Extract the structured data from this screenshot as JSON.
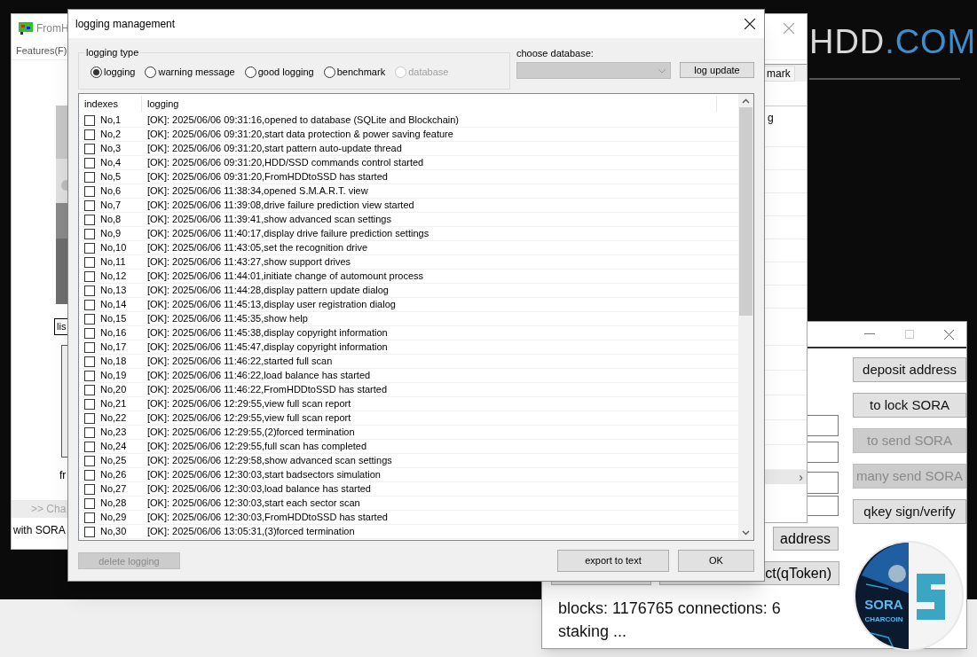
{
  "desktop": {
    "brand": "HDD",
    "brand_suffix": ".COM"
  },
  "background_window": {
    "title": "FromH",
    "menu": [
      "Features(F)"
    ],
    "tab": "mark",
    "list_text": "g",
    "field_text": "lis",
    "label": "fr",
    "bar_text": ">> Cha",
    "status_text": "with SORA"
  },
  "dropdown_list": {
    "arrow": "›"
  },
  "wallet_window": {
    "buttons": [
      {
        "label": "deposit address",
        "disabled": false
      },
      {
        "label": "to lock SORA",
        "disabled": false
      },
      {
        "label": "to send SORA",
        "disabled": true
      },
      {
        "label": "many send SORA",
        "disabled": true
      },
      {
        "label": "qkey sign/verify",
        "disabled": false
      }
    ],
    "address_button": "address",
    "token_button": "ct(qToken)",
    "status_lines": [
      "blocks: 1176765 connections: 6",
      "staking ..."
    ],
    "logo": {
      "title": "SORA",
      "subtitle": "CHARCOIN"
    }
  },
  "dialog": {
    "title": "logging management",
    "group_label": "logging type",
    "radios": [
      {
        "label": "logging",
        "selected": true,
        "disabled": false
      },
      {
        "label": "warning message",
        "selected": false,
        "disabled": false
      },
      {
        "label": "good logging",
        "selected": false,
        "disabled": false
      },
      {
        "label": "benchmark",
        "selected": false,
        "disabled": false
      },
      {
        "label": "database",
        "selected": false,
        "disabled": true
      }
    ],
    "database_label": "choose database:",
    "update_button": "log update",
    "columns": [
      "indexes",
      "logging"
    ],
    "rows": [
      {
        "index": "No,1",
        "text": "[OK]: 2025/06/06 09:31:16,opened to database (SQLite and Blockchain)",
        "checked": false
      },
      {
        "index": "No,2",
        "text": "[OK]: 2025/06/06 09:31:20,start data protection & power saving feature",
        "checked": false
      },
      {
        "index": "No,3",
        "text": "[OK]: 2025/06/06 09:31:20,start pattern auto-update thread",
        "checked": false
      },
      {
        "index": "No,4",
        "text": "[OK]: 2025/06/06 09:31:20,HDD/SSD commands control started",
        "checked": false
      },
      {
        "index": "No,5",
        "text": "[OK]: 2025/06/06 09:31:20,FromHDDtoSSD has started",
        "checked": false
      },
      {
        "index": "No,6",
        "text": "[OK]: 2025/06/06 11:38:34,opened S.M.A.R.T. view",
        "checked": false
      },
      {
        "index": "No,7",
        "text": "[OK]: 2025/06/06 11:39:08,drive failure prediction view started",
        "checked": false
      },
      {
        "index": "No,8",
        "text": "[OK]: 2025/06/06 11:39:41,show advanced scan settings",
        "checked": false
      },
      {
        "index": "No,9",
        "text": "[OK]: 2025/06/06 11:40:17,display drive failure prediction settings",
        "checked": false
      },
      {
        "index": "No,10",
        "text": "[OK]: 2025/06/06 11:43:05,set the recognition drive",
        "checked": false
      },
      {
        "index": "No,11",
        "text": "[OK]: 2025/06/06 11:43:27,show support drives",
        "checked": false
      },
      {
        "index": "No,12",
        "text": "[OK]: 2025/06/06 11:44:01,initiate change of automount process",
        "checked": false
      },
      {
        "index": "No,13",
        "text": "[OK]: 2025/06/06 11:44:28,display pattern update dialog",
        "checked": false
      },
      {
        "index": "No,14",
        "text": "[OK]: 2025/06/06 11:45:13,display user registration dialog",
        "checked": false
      },
      {
        "index": "No,15",
        "text": "[OK]: 2025/06/06 11:45:35,show help",
        "checked": false
      },
      {
        "index": "No,16",
        "text": "[OK]: 2025/06/06 11:45:38,display copyright information",
        "checked": false
      },
      {
        "index": "No,17",
        "text": "[OK]: 2025/06/06 11:45:47,display copyright information",
        "checked": false
      },
      {
        "index": "No,18",
        "text": "[OK]: 2025/06/06 11:46:22,started full scan",
        "checked": false
      },
      {
        "index": "No,19",
        "text": "[OK]: 2025/06/06 11:46:22,load balance has started",
        "checked": false
      },
      {
        "index": "No,20",
        "text": "[OK]: 2025/06/06 11:46:22,FromHDDtoSSD has started",
        "checked": false
      },
      {
        "index": "No,21",
        "text": "[OK]: 2025/06/06 12:29:55,view full scan report",
        "checked": false
      },
      {
        "index": "No,22",
        "text": "[OK]: 2025/06/06 12:29:55,view full scan report",
        "checked": false
      },
      {
        "index": "No,23",
        "text": "[OK]: 2025/06/06 12:29:55,(2)forced termination",
        "checked": false
      },
      {
        "index": "No,24",
        "text": "[OK]: 2025/06/06 12:29:55,full scan has completed",
        "checked": false
      },
      {
        "index": "No,25",
        "text": "[OK]: 2025/06/06 12:29:58,show advanced scan settings",
        "checked": false
      },
      {
        "index": "No,26",
        "text": "[OK]: 2025/06/06 12:30:03,start badsectors simulation",
        "checked": false
      },
      {
        "index": "No,27",
        "text": "[OK]: 2025/06/06 12:30:03,load balance has started",
        "checked": false
      },
      {
        "index": "No,28",
        "text": "[OK]: 2025/06/06 12:30:03,start each sector scan",
        "checked": false
      },
      {
        "index": "No,29",
        "text": "[OK]: 2025/06/06 12:30:03,FromHDDtoSSD has started",
        "checked": false
      },
      {
        "index": "No,30",
        "text": "[OK]: 2025/06/06 13:05:31,(3)forced termination",
        "checked": false
      }
    ],
    "delete_button": {
      "label": "delete logging",
      "disabled": true
    },
    "export_button": "export to text",
    "ok_button": "OK"
  }
}
